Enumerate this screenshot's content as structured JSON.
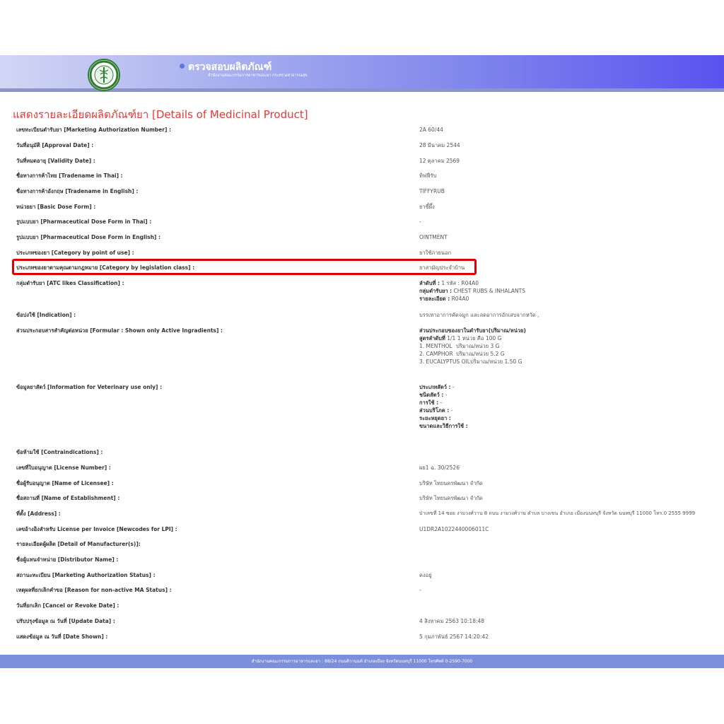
{
  "header": {
    "site_title": "ตรวจสอบผลิตภัณฑ์",
    "site_subtitle": "สำนักงานคณะกรรมการอาหารและยา กระทรวงสาธารณสุข"
  },
  "page_title": "แสดงรายละเอียดผลิตภัณฑ์ยา [Details of Medicinal Product]",
  "fields": {
    "ma_number": {
      "label": "เลขทะเบียนตำรับยา [Marketing Authorization Number] :",
      "value": "2A 60/44"
    },
    "approval_date": {
      "label": "วันที่อนุมัติ [Approval Date] :",
      "value": "28 มีนาคม 2544"
    },
    "validity_date": {
      "label": "วันที่หมดอายุ [Validity Date] :",
      "value": "12 ตุลาคม 2569"
    },
    "tradename_thai": {
      "label": "ชื่อทางการค้าไทย [Tradename in Thai] :",
      "value": "ทิฟฟี่รับ"
    },
    "tradename_english": {
      "label": "ชื่อทางการค้าอังกฤษ [Tradename in English] :",
      "value": "TIFFYRUB"
    },
    "basic_dose_form": {
      "label": "หน่วยยา [Basic Dose Form] :",
      "value": "ยาขี้ผึ้ง"
    },
    "dose_form_thai": {
      "label": "รูปแบบยา [Pharmaceutical Dose Form in Thai] :",
      "value": "-"
    },
    "dose_form_english": {
      "label": "รูปแบบยา [Pharmaceutical Dose Form in English] :",
      "value": "OINTMENT"
    },
    "category_use": {
      "label": "ประเภทของยา [Category by point of use] :",
      "value": "ยาใช้ภายนอก"
    },
    "category_legislation": {
      "label": "ประเภทของยาตามคุณตามกฎหมาย [Category by legislation class] :",
      "value": "ยาสามัญประจำบ้าน"
    },
    "atc": {
      "label": "กลุ่มตำรับยา [ATC likes Classification] :",
      "lines": [
        {
          "bold": "ลำดับที่ :",
          "text": " 1 รหัส : R04A0"
        },
        {
          "bold": "กลุ่มตำรับยา :",
          "text": " CHEST RUBS & INHALANTS"
        },
        {
          "bold": "รายละเอียด :",
          "text": " R04A0"
        }
      ]
    },
    "indication": {
      "label": "ข้อบ่งใช้ [Indication] :",
      "value": "บรรเทาอาการคัดจมูก และลดอาการอักเสบจากหวัด ,"
    },
    "formula": {
      "label": "ส่วนประกอบสารสำคัญต่อหน่วย [Formular : Shown only Active Ingradients] :",
      "heading": "ส่วนประกอบของยาในตำรับยา(ปริมาณ/หน่วย)",
      "formula_line_bold": "สูตรลำดับที่",
      "formula_line_text": " 1/1 1 หน่วย คือ 100 G",
      "ingredients": [
        {
          "name": "1. MENTHOL",
          "amount": "ปริมาณ/หน่วย  3 G"
        },
        {
          "name": "2. CAMPHOR",
          "amount": "ปริมาณ/หน่วย  5.2 G"
        },
        {
          "name": "3. EUCALYPTUS OIL",
          "amount": "ปริมาณ/หน่วย  1.50 G"
        }
      ]
    },
    "veterinary": {
      "label": "ข้อมูลยาสัตว์ [Information for Veterinary use only] :",
      "lines": [
        {
          "bold": "ประเภทสัตว์ :",
          "text": " -"
        },
        {
          "bold": "ชนิดสัตว์ :",
          "text": " -"
        },
        {
          "bold": "การใช้ :",
          "text": " -"
        },
        {
          "bold": "ส่วนบริโภค :",
          "text": " -"
        },
        {
          "bold": "ระยะหยุดยา :",
          "text": ""
        },
        {
          "bold": "ขนาดและวิธีการใช้ :",
          "text": ""
        }
      ]
    },
    "contraindications": {
      "label": "ข้อห้ามใช้ [Contraindications] :",
      "value": ""
    },
    "license_number": {
      "label": "เลขที่ใบอนุญาต [License Number] :",
      "value": "ผย1 ฉ. 30/2526"
    },
    "licensee": {
      "label": "ชื่อผู้รับอนุญาต [Name of Licensee] :",
      "value": "บริษัท ไทยนครพัฒนา จำกัด"
    },
    "establishment": {
      "label": "ชื่อสถานที่ [Name of Establishment] :",
      "value": "บริษัท ไทยนครพัฒนา จำกัด"
    },
    "address": {
      "label": "ที่ตั้ง [Address] :",
      "value": "ป่าเลขที่ 14 ซอย งามวงศ์วาน 8 ถนน งามวงศ์วาน ตำบล บางเขน อำเภอ เมืองนนทบุรี จังหวัด นนทบุรี 11000 โทร.0 2555 9999"
    },
    "lpi": {
      "label": "เลขอ้างอิงสำหรับ License per Invoice [Newcodes for LPI] :",
      "value": "U1DR2A1022440006011C"
    },
    "manufacturer": {
      "label": "รายละเอียดผู้ผลิต [Detail of Manufacturer(s)]:",
      "value": ""
    },
    "distributor": {
      "label": "ชื่อผู้แทนจำหน่าย [Distributor Name] :",
      "value": ""
    },
    "ma_status": {
      "label": "สถานะทะเบียน [Marketing Authorization Status] :",
      "value": "คงอยู่"
    },
    "reason_non_active": {
      "label": "เหตุผลที่ยกเลิกคำขอ [Reason for non-active MA Status] :",
      "value": "-"
    },
    "cancel_date": {
      "label": "วันที่ยกเลิก [Cancel or Revoke Date] :",
      "value": ""
    },
    "update_data": {
      "label": "ปรับปรุงข้อมูล ณ วันที่ [Update Data] :",
      "value": "4 สิงหาคม 2563 10:18:48"
    },
    "date_shown": {
      "label": "แสดงข้อมูล ณ วันที่ [Date Shown] :",
      "value": "5 กุมภาพันธ์ 2567 14:20:42"
    }
  },
  "footer": {
    "text": "สำนักงานคณะกรรมการอาหารและยา : 88/24 ถนนติวานนท์ อำเภอเมือง จังหวัดนนทบุรี 11000 โทรศัพท์ 0-2590-7000"
  },
  "colors": {
    "title_red": "#e53935",
    "highlight_red": "#e00000",
    "header_start": "#d2d6f5",
    "header_end": "#5a52f0",
    "footer": "#7b8fdc"
  }
}
